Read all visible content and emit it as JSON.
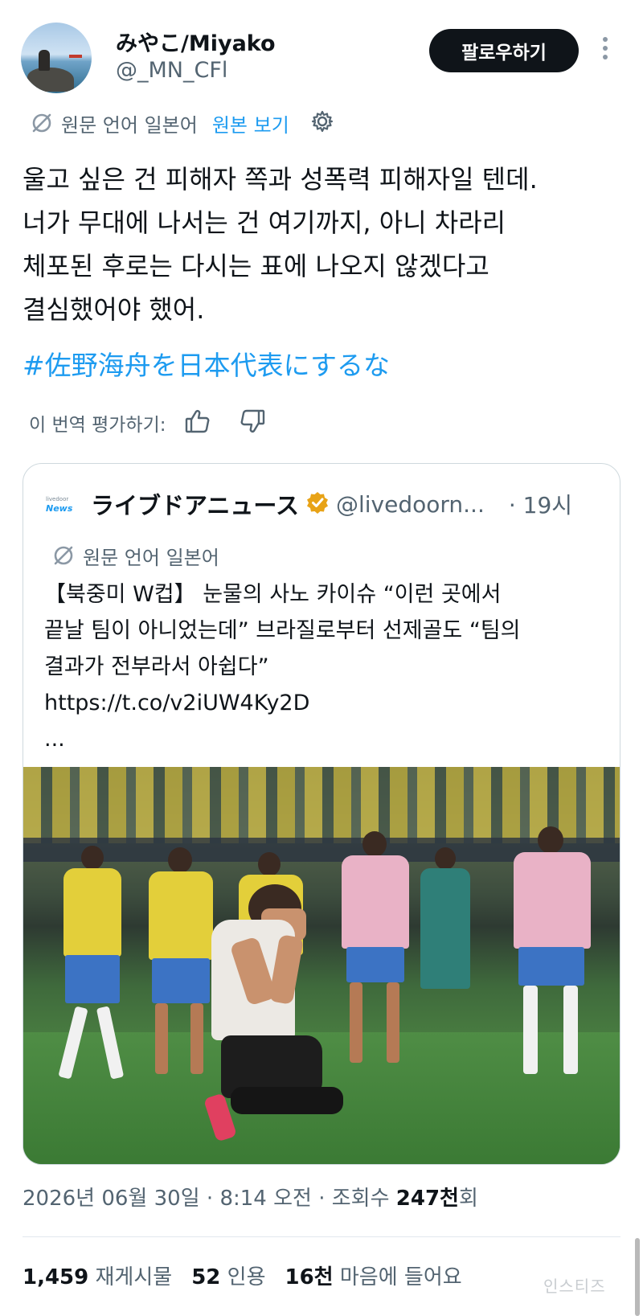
{
  "author": {
    "display_name": "みやこ/Miyako",
    "handle": "@_MN_CFl",
    "follow_label": "팔로우하기"
  },
  "translation": {
    "source_language": "원문 언어 일본어",
    "view_original": "원본 보기",
    "rate_label": "이 번역 평가하기:"
  },
  "tweet": {
    "lines": [
      "울고 싶은 건 피해자 쪽과 성폭력 피해자일 텐데.",
      "너가 무대에 나서는 건 여기까지, 아니 차라리",
      "체포된 후로는 다시는 표에 나오지 않겠다고",
      "결심했어야 했어."
    ],
    "hashtag": "#佐野海舟を日本代表にするな"
  },
  "quoted": {
    "logo_small": "livedoor",
    "logo_main": "News",
    "name": "ライブドアニュース",
    "handle": "@livedoorn...",
    "time": "· 19시",
    "source_language": "원문 언어 일본어",
    "lines": [
      "【북중미 W컵】 눈물의 사노 카이슈 “이런 곳에서",
      "끝날 팀이 아니었는데” 브라질로부터 선제골도 “팀의",
      "결과가 전부라서 아쉽다”",
      "https://t.co/v2iUW4Ky2D",
      "..."
    ]
  },
  "meta": {
    "date": "2026년 06월 30일",
    "sep1": " · ",
    "time": "8:14 오전",
    "sep2": " · ",
    "views_label": "조회수 ",
    "views_value": "247천",
    "views_suffix": "회"
  },
  "stats": {
    "reposts_value": "1,459",
    "reposts_label": " 재게시물",
    "quotes_value": "52",
    "quotes_label": " 인용",
    "likes_value": "16천",
    "likes_label": " 마음에 들어요"
  },
  "watermark": "인스티즈",
  "colors": {
    "accent": "#1d9bf0",
    "text_primary": "#0f1419",
    "text_secondary": "#536471",
    "verified_badge": "#e8a317"
  },
  "icons": [
    "more-vertical-icon",
    "translate-icon",
    "settings-gear-icon",
    "thumbs-up-icon",
    "thumbs-down-icon",
    "verified-badge-icon"
  ]
}
